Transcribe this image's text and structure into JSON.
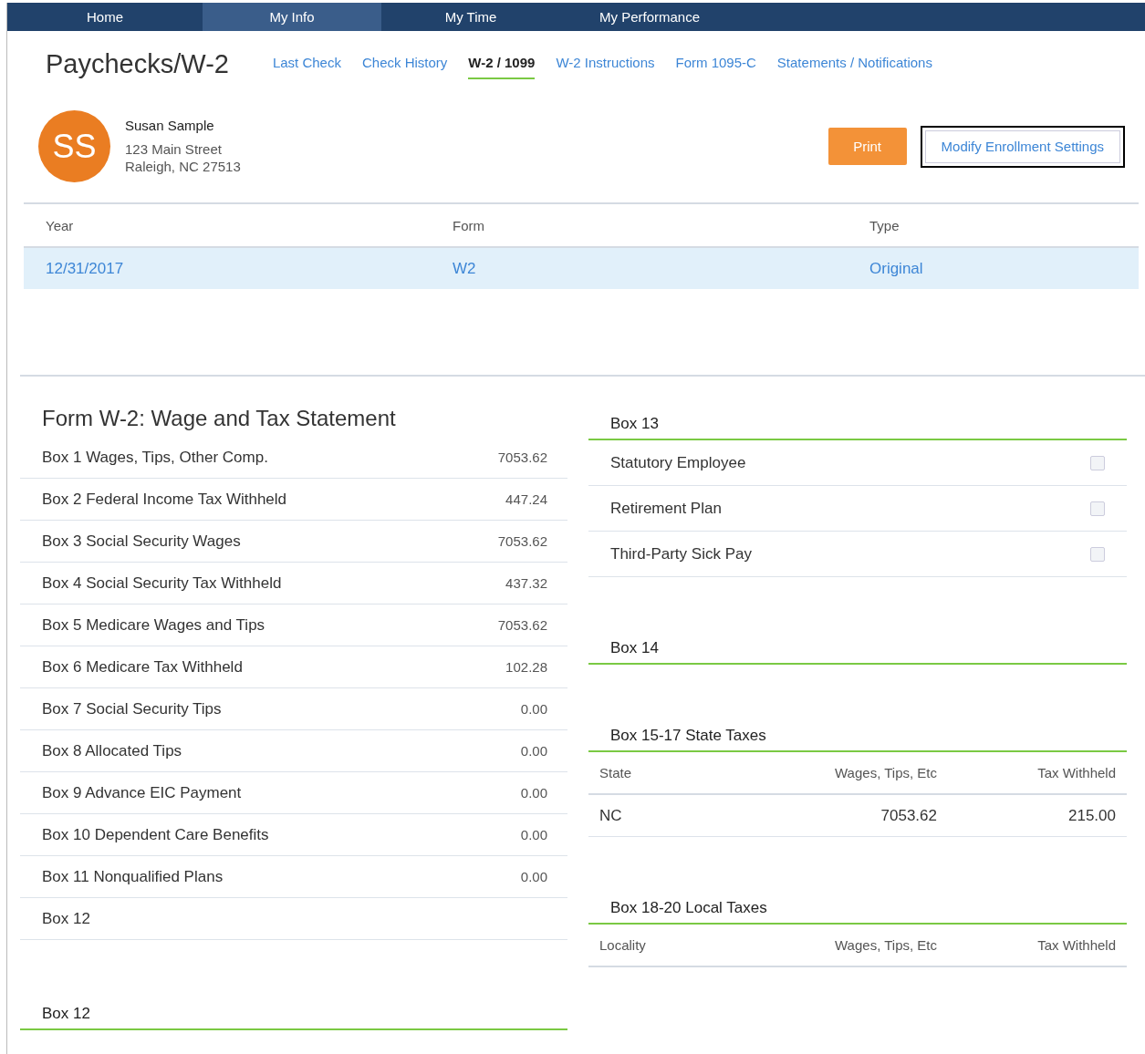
{
  "nav": [
    {
      "label": "Home",
      "selected": false
    },
    {
      "label": "My Info",
      "selected": true
    },
    {
      "label": "My Time",
      "selected": false
    },
    {
      "label": "My Performance",
      "selected": false
    }
  ],
  "page_title": "Paychecks/W-2",
  "subnav": [
    {
      "label": "Last Check",
      "selected": false
    },
    {
      "label": "Check History",
      "selected": false
    },
    {
      "label": "W-2 / 1099",
      "selected": true
    },
    {
      "label": "W-2 Instructions",
      "selected": false
    },
    {
      "label": "Form 1095-C",
      "selected": false
    },
    {
      "label": "Statements / Notifications",
      "selected": false
    }
  ],
  "profile": {
    "initials": "SS",
    "name": "Susan Sample",
    "address_lines": [
      "123 Main Street",
      "Raleigh, NC 27513"
    ]
  },
  "buttons": [
    {
      "label": "Print",
      "kind": "primary"
    },
    {
      "label": "Modify Enrollment Settings",
      "kind": "outline"
    }
  ],
  "forms_table": {
    "columns": [
      "Year",
      "Form",
      "Type"
    ],
    "rows": [
      {
        "cells": [
          "12/31/2017",
          "W2",
          "Original"
        ],
        "selected": true
      }
    ]
  },
  "w2": {
    "title": "Form W-2: Wage and Tax Statement",
    "rows": [
      {
        "label": "Box 1 Wages, Tips, Other Comp.",
        "value": "7053.62"
      },
      {
        "label": "Box 2 Federal Income Tax Withheld",
        "value": "447.24"
      },
      {
        "label": "Box 3 Social Security Wages",
        "value": "7053.62"
      },
      {
        "label": "Box 4 Social Security Tax Withheld",
        "value": "437.32"
      },
      {
        "label": "Box 5 Medicare Wages and Tips",
        "value": "7053.62"
      },
      {
        "label": "Box 6 Medicare Tax Withheld",
        "value": "102.28"
      },
      {
        "label": "Box 7 Social Security Tips",
        "value": "0.00"
      },
      {
        "label": "Box 8 Allocated Tips",
        "value": "0.00"
      },
      {
        "label": "Box 9 Advance EIC Payment",
        "value": "0.00"
      },
      {
        "label": "Box 10 Dependent Care Benefits",
        "value": "0.00"
      },
      {
        "label": "Box 11 Nonqualified Plans",
        "value": "0.00"
      },
      {
        "label": "Box 12"
      }
    ],
    "box12_heading": "Box 12"
  },
  "box13": {
    "title": "Box 13",
    "items": [
      {
        "label": "Statutory Employee",
        "checked": false
      },
      {
        "label": "Retirement Plan",
        "checked": false
      },
      {
        "label": "Third-Party Sick Pay",
        "checked": false
      }
    ]
  },
  "box14": {
    "title": "Box 14"
  },
  "state_taxes": {
    "title": "Box 15-17 State Taxes",
    "columns": [
      "State",
      "Wages, Tips, Etc",
      "Tax Withheld"
    ],
    "rows": [
      {
        "cells": [
          "NC",
          "7053.62",
          "215.00"
        ]
      }
    ]
  },
  "local_taxes": {
    "title": "Box 18-20 Local Taxes",
    "columns": [
      "Locality",
      "Wages, Tips, Etc",
      "Tax Withheld"
    ]
  }
}
